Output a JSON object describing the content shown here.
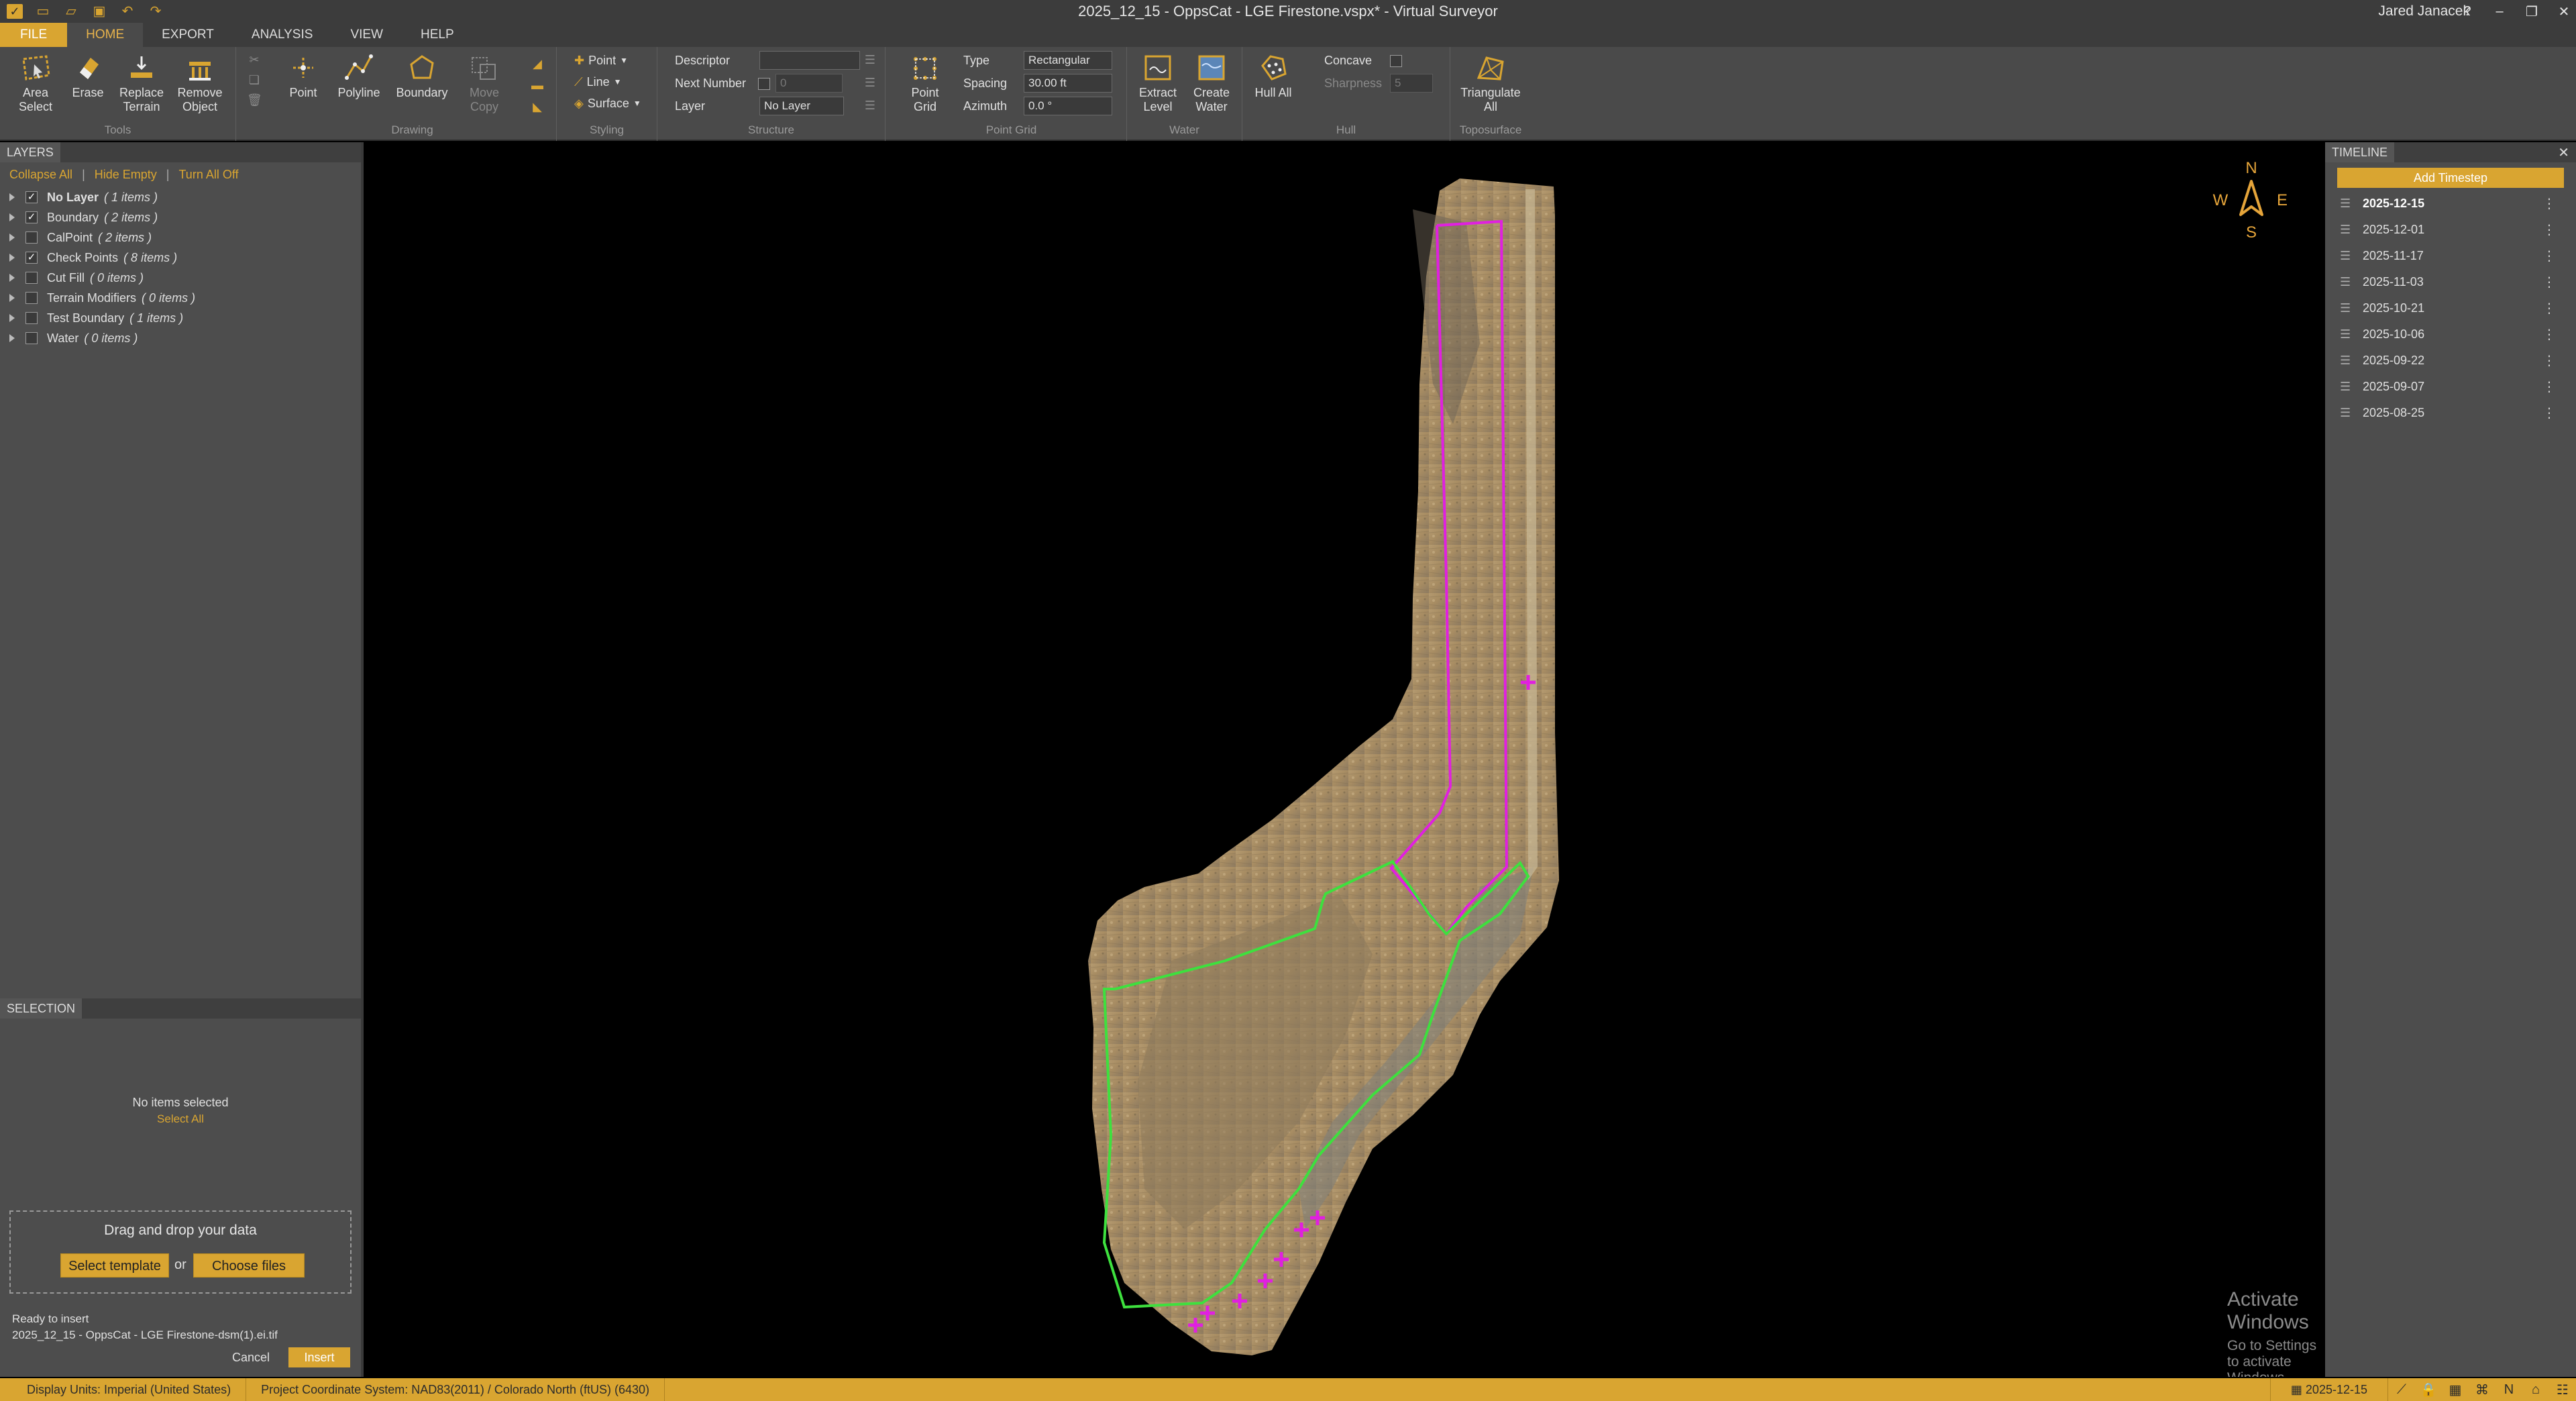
{
  "window": {
    "title": "2025_12_15 - OppsCat - LGE Firestone.vspx*  -  Virtual Surveyor",
    "user": "Jared Janacek"
  },
  "menu": {
    "file": "FILE",
    "tabs": [
      "HOME",
      "EXPORT",
      "ANALYSIS",
      "VIEW",
      "HELP"
    ]
  },
  "ribbon": {
    "tools": {
      "area_select": "Area Select",
      "erase": "Erase",
      "replace_terrain": "Replace Terrain",
      "remove_object": "Remove Object",
      "label": "Tools"
    },
    "drawing": {
      "point": "Point",
      "polyline": "Polyline",
      "boundary": "Boundary",
      "move_copy": "Move Copy",
      "label": "Drawing"
    },
    "styling": {
      "point": "Point",
      "line": "Line",
      "surface": "Surface",
      "label": "Styling"
    },
    "structure": {
      "descriptor": "Descriptor",
      "next_number": "Next Number",
      "next_number_value": "0",
      "layer": "Layer",
      "layer_value": "No Layer",
      "label": "Structure"
    },
    "point_grid": {
      "button": "Point Grid",
      "type_label": "Type",
      "type_value": "Rectangular",
      "spacing_label": "Spacing",
      "spacing_value": "30.00 ft",
      "azimuth_label": "Azimuth",
      "azimuth_value": "0.0 °",
      "label": "Point Grid"
    },
    "water": {
      "extract_level": "Extract Level",
      "create_water": "Create Water",
      "label": "Water"
    },
    "hull": {
      "hull_all": "Hull All",
      "concave": "Concave",
      "sharpness": "Sharpness",
      "sharpness_value": "5",
      "label": "Hull"
    },
    "toposurface": {
      "triangulate_all": "Triangulate All",
      "label": "Toposurface"
    }
  },
  "layers_panel": {
    "tab": "LAYERS",
    "collapse_all": "Collapse All",
    "hide_empty": "Hide Empty",
    "turn_all_off": "Turn All Off",
    "items": [
      {
        "name": "No Layer",
        "count": "( 1 items )",
        "checked": true,
        "bold": true
      },
      {
        "name": "Boundary",
        "count": "( 2 items )",
        "checked": true,
        "bold": false
      },
      {
        "name": "CalPoint",
        "count": "( 2 items )",
        "checked": false,
        "bold": false
      },
      {
        "name": "Check Points",
        "count": "( 8 items )",
        "checked": true,
        "bold": false
      },
      {
        "name": "Cut Fill",
        "count": "( 0 items )",
        "checked": false,
        "bold": false
      },
      {
        "name": "Terrain Modifiers",
        "count": "( 0 items )",
        "checked": false,
        "bold": false
      },
      {
        "name": "Test Boundary",
        "count": "( 1 items )",
        "checked": false,
        "bold": false
      },
      {
        "name": "Water",
        "count": "( 0 items )",
        "checked": false,
        "bold": false
      }
    ]
  },
  "selection_panel": {
    "tab": "SELECTION",
    "empty_text": "No items selected",
    "select_all": "Select All"
  },
  "dropzone": {
    "title": "Drag and drop your data",
    "select_template": "Select template",
    "or": "or",
    "choose_files": "Choose files",
    "status": "Ready to insert",
    "filename": "2025_12_15 - OppsCat - LGE Firestone-dsm(1).ei.tif",
    "cancel": "Cancel",
    "insert": "Insert"
  },
  "map": {
    "compass": {
      "n": "N",
      "s": "S",
      "e": "E",
      "w": "W"
    },
    "watermark_title": "Activate Windows",
    "watermark_sub": "Go to Settings to activate Windows.",
    "boundary_colors": {
      "magenta": "#e020e0",
      "green": "#3ee03e"
    }
  },
  "timeline": {
    "tab": "TIMELINE",
    "add": "Add Timestep",
    "steps": [
      {
        "date": "2025-12-15",
        "active": true
      },
      {
        "date": "2025-12-01",
        "active": false
      },
      {
        "date": "2025-11-17",
        "active": false
      },
      {
        "date": "2025-11-03",
        "active": false
      },
      {
        "date": "2025-10-21",
        "active": false
      },
      {
        "date": "2025-10-06",
        "active": false
      },
      {
        "date": "2025-09-22",
        "active": false
      },
      {
        "date": "2025-09-07",
        "active": false
      },
      {
        "date": "2025-08-25",
        "active": false
      }
    ]
  },
  "statusbar": {
    "display_units": "Display Units:  Imperial (United States)",
    "coord_system": "Project Coordinate System:  NAD83(2011) / Colorado North (ftUS) (6430)",
    "date": "2025-12-15"
  },
  "colors": {
    "accent": "#d9a531",
    "ribbon": "#4a4a4a",
    "panel": "#4d4d4d"
  }
}
